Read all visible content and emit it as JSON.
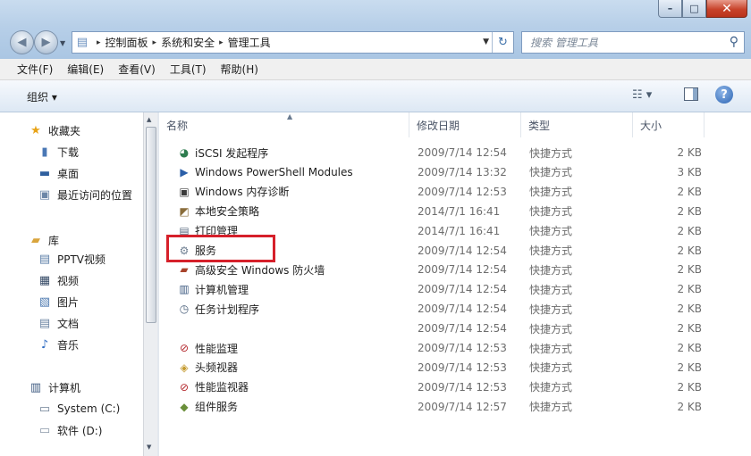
{
  "window": {
    "minimize_glyph": "–",
    "maximize_glyph": "□",
    "close_glyph": "✕"
  },
  "nav": {
    "back_glyph": "◀",
    "forward_glyph": "▶",
    "history_glyph": "▼"
  },
  "address": {
    "folder_icon": "folder-icon",
    "crumbs": [
      "控制面板",
      "系统和安全",
      "管理工具"
    ],
    "separator": "▸",
    "dropdown_glyph": "▼",
    "refresh_glyph": "↻"
  },
  "search": {
    "placeholder": "搜索 管理工具",
    "icon_glyph": "⚲"
  },
  "menu": [
    "文件(F)",
    "编辑(E)",
    "查看(V)",
    "工具(T)",
    "帮助(H)"
  ],
  "toolbar": {
    "organize_label": "组织 ▾",
    "view_glyph": "☷ ▾",
    "help_glyph": "?"
  },
  "sidebar": {
    "groups": [
      {
        "label": "收藏夹",
        "icon": "star-icon",
        "glyph": "★",
        "color": "#e8a317",
        "items": [
          {
            "label": "下载",
            "icon": "download-folder-icon",
            "glyph": "▮",
            "color": "#4a78b5"
          },
          {
            "label": "桌面",
            "icon": "desktop-icon",
            "glyph": "▬",
            "color": "#2f5f9e"
          },
          {
            "label": "最近访问的位置",
            "icon": "recent-places-icon",
            "glyph": "▣",
            "color": "#6d87a8"
          }
        ]
      },
      {
        "label": "库",
        "icon": "library-icon",
        "glyph": "▰",
        "color": "#d9a53c",
        "items": [
          {
            "label": "PPTV视频",
            "icon": "pptv-video-icon",
            "glyph": "▤",
            "color": "#5d7fa8"
          },
          {
            "label": "视频",
            "icon": "video-library-icon",
            "glyph": "▦",
            "color": "#354a66"
          },
          {
            "label": "图片",
            "icon": "pictures-library-icon",
            "glyph": "▧",
            "color": "#4e7ab0"
          },
          {
            "label": "文档",
            "icon": "documents-library-icon",
            "glyph": "▤",
            "color": "#6b84a3"
          },
          {
            "label": "音乐",
            "icon": "music-library-icon",
            "glyph": "♪",
            "color": "#2f6cc2"
          }
        ]
      },
      {
        "label": "计算机",
        "icon": "computer-icon",
        "glyph": "▥",
        "color": "#3d5a80",
        "items": [
          {
            "label": "System (C:)",
            "icon": "system-drive-icon",
            "glyph": "▭",
            "color": "#6d7f95"
          },
          {
            "label": "软件 (D:)",
            "icon": "drive-icon",
            "glyph": "▭",
            "color": "#8a97a8"
          }
        ]
      }
    ]
  },
  "columns": {
    "name": "名称",
    "date": "修改日期",
    "type": "类型",
    "size": "大小",
    "sort_glyph": "▲"
  },
  "files": [
    {
      "name": "iSCSI 发起程序",
      "date": "2009/7/14 12:54",
      "type": "快捷方式",
      "size": "2 KB",
      "icon": "iscsi-initiator-icon",
      "glyph": "◕",
      "color": "#2e7d4f"
    },
    {
      "name": "Windows PowerShell Modules",
      "date": "2009/7/14 13:32",
      "type": "快捷方式",
      "size": "3 KB",
      "icon": "powershell-icon",
      "glyph": "▶",
      "color": "#2b5fa8"
    },
    {
      "name": "Windows 内存诊断",
      "date": "2009/7/14 12:53",
      "type": "快捷方式",
      "size": "2 KB",
      "icon": "memory-diagnostic-icon",
      "glyph": "▣",
      "color": "#3b3b3b"
    },
    {
      "name": "本地安全策略",
      "date": "2014/7/1 16:41",
      "type": "快捷方式",
      "size": "2 KB",
      "icon": "security-policy-icon",
      "glyph": "◩",
      "color": "#8a6d3b"
    },
    {
      "name": "打印管理",
      "date": "2014/7/1 16:41",
      "type": "快捷方式",
      "size": "2 KB",
      "icon": "print-management-icon",
      "glyph": "▤",
      "color": "#5a6b80"
    },
    {
      "name": "服务",
      "date": "2009/7/14 12:54",
      "type": "快捷方式",
      "size": "2 KB",
      "icon": "services-gear-icon",
      "glyph": "⚙",
      "color": "#6f7f92"
    },
    {
      "name": "高级安全 Windows 防火墙",
      "date": "2009/7/14 12:54",
      "type": "快捷方式",
      "size": "2 KB",
      "icon": "firewall-icon",
      "glyph": "▰",
      "color": "#a8432b"
    },
    {
      "name": "计算机管理",
      "date": "2009/7/14 12:54",
      "type": "快捷方式",
      "size": "2 KB",
      "icon": "computer-management-icon",
      "glyph": "▥",
      "color": "#3d5a80"
    },
    {
      "name": "任务计划程序",
      "date": "2009/7/14 12:54",
      "type": "快捷方式",
      "size": "2 KB",
      "icon": "task-scheduler-icon",
      "glyph": "◷",
      "color": "#4a5f7a"
    },
    {
      "name": "",
      "date": "2009/7/14 12:54",
      "type": "快捷方式",
      "size": "2 KB",
      "icon": "",
      "glyph": "",
      "color": "#ffffff"
    },
    {
      "name": "性能监理",
      "date": "2009/7/14 12:53",
      "type": "快捷方式",
      "size": "2 KB",
      "icon": "performance-monitor-icon",
      "glyph": "⊘",
      "color": "#b3262b"
    },
    {
      "name": "头频视器",
      "date": "2009/7/14 12:53",
      "type": "快捷方式",
      "size": "2 KB",
      "icon": "event-viewer-icon",
      "glyph": "◈",
      "color": "#c49a2e"
    },
    {
      "name": "性能监视器",
      "date": "2009/7/14 12:53",
      "type": "快捷方式",
      "size": "2 KB",
      "icon": "performance-monitor-icon",
      "glyph": "⊘",
      "color": "#b3262b"
    },
    {
      "name": "组件服务",
      "date": "2009/7/14 12:57",
      "type": "快捷方式",
      "size": "2 KB",
      "icon": "component-services-icon",
      "glyph": "◆",
      "color": "#6a8f3a"
    }
  ],
  "highlight_color": "#d6202a"
}
